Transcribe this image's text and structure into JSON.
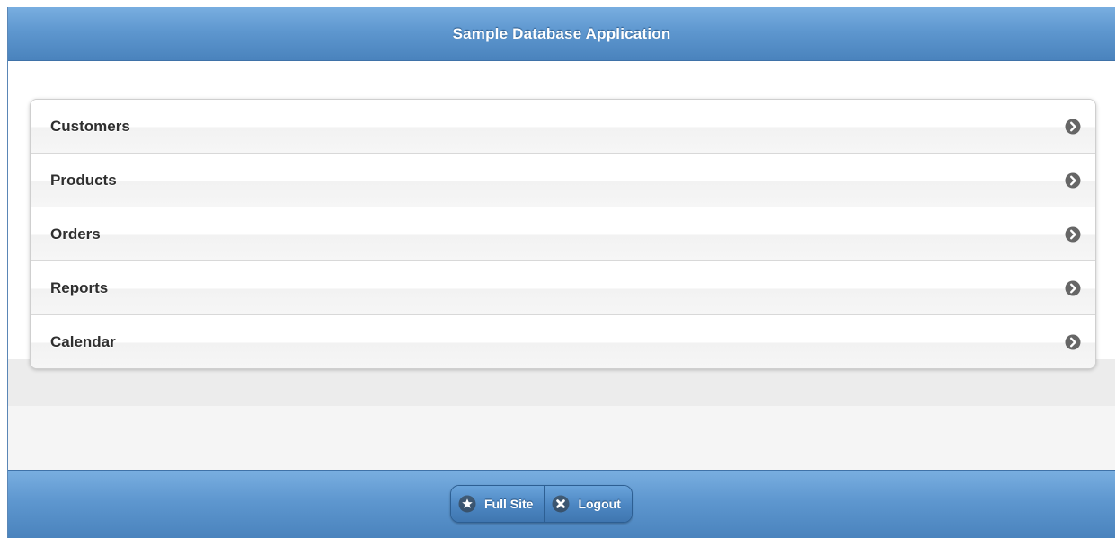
{
  "header": {
    "title": "Sample Database Application"
  },
  "menu": {
    "items": [
      {
        "label": "Customers",
        "icon": "chevron-right-circle-icon"
      },
      {
        "label": "Products",
        "icon": "chevron-right-circle-icon"
      },
      {
        "label": "Orders",
        "icon": "chevron-right-circle-icon"
      },
      {
        "label": "Reports",
        "icon": "chevron-right-circle-icon"
      },
      {
        "label": "Calendar",
        "icon": "chevron-right-circle-icon"
      }
    ]
  },
  "footer": {
    "full_site_label": "Full Site",
    "full_site_icon": "star-icon",
    "logout_label": "Logout",
    "logout_icon": "close-icon"
  },
  "colors": {
    "bar_blue": "#5e97cf",
    "list_text": "#2f2f2f",
    "arrow_gray": "#666666"
  }
}
